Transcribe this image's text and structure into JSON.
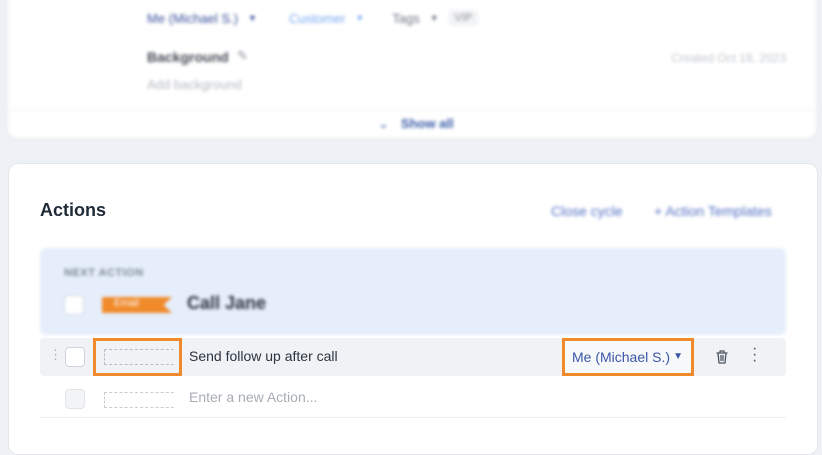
{
  "top": {
    "assignee": "Me (Michael S.)",
    "type": "Customer",
    "tags_label": "Tags",
    "tag_vip": "VIP",
    "background_label": "Background",
    "background_placeholder": "Add background",
    "created": "Created Oct 18, 2023",
    "show_all": "Show all"
  },
  "actions": {
    "title": "Actions",
    "close_cycle": "Close cycle",
    "templates": "Action Templates",
    "next": {
      "label": "NEXT ACTION",
      "flag": "Email",
      "title": "Call Jane"
    },
    "rows": [
      {
        "text": "Send follow up after call",
        "assignee": "Me (Michael S.)"
      }
    ],
    "new_placeholder": "Enter a new Action..."
  },
  "colors": {
    "highlight": "#f08a2a",
    "link": "#3b56a8",
    "next_bg": "#e6eefb"
  }
}
